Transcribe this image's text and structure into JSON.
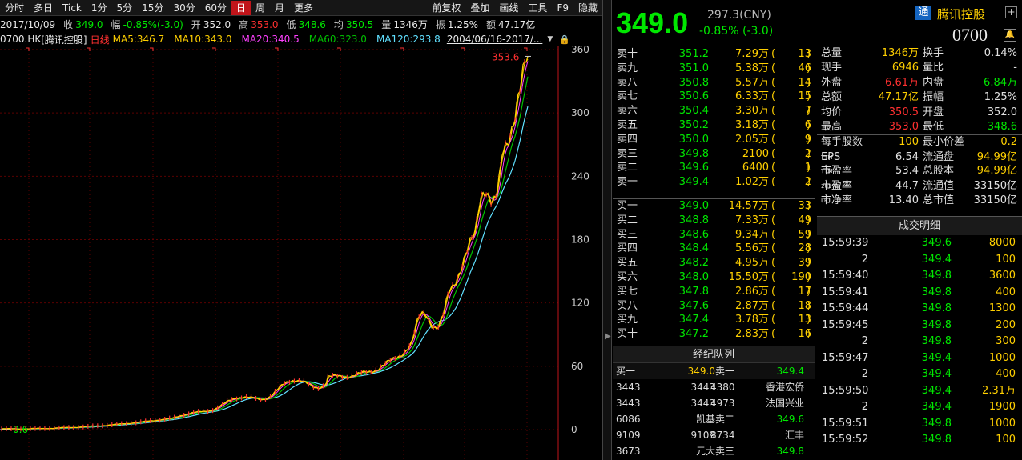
{
  "nav": {
    "tabs": [
      "分时",
      "多日",
      "Tick",
      "1分",
      "5分",
      "15分",
      "30分",
      "60分",
      "日",
      "周",
      "月",
      "更多"
    ],
    "active": 8,
    "tools": [
      "前复权",
      "叠加",
      "画线",
      "工具",
      "F9",
      "隐藏"
    ]
  },
  "info": {
    "date": "2017/10/09",
    "close_lbl": "收",
    "close": "349.0",
    "range_lbl": "幅",
    "range": "-0.85%(-3.0)",
    "open_lbl": "开",
    "open": "352.0",
    "high_lbl": "高",
    "high": "353.0",
    "low_lbl": "低",
    "low": "348.6",
    "avg_lbl": "均",
    "avg": "350.5",
    "vol_lbl": "量",
    "vol": "1346万",
    "amp_lbl": "振",
    "amp": "1.25%",
    "amt_lbl": "额",
    "amt": "47.17亿"
  },
  "ma": {
    "symbol": "0700.HK",
    "name": "[腾讯控股]",
    "period": "日线",
    "ma5": "MA5:346.7",
    "ma10": "MA10:343.0",
    "ma20": "MA20:340.5",
    "ma60": "MA60:323.0",
    "ma120": "MA120:293.8",
    "range": "2004/06/16-2017/..."
  },
  "chart": {
    "y_ticks": [
      "360",
      "300",
      "240",
      "180",
      "120",
      "60",
      "0"
    ],
    "high_label": "353.6",
    "low_label": "0.6"
  },
  "quote": {
    "price": "349.0",
    "prev": "297.3(CNY)",
    "change": "-0.85% (-3.0)",
    "tong": "通",
    "name": "腾讯控股",
    "code": "0700"
  },
  "asks": [
    {
      "lbl": "卖十",
      "price": "351.2",
      "vol": "7.29万",
      "cnt": "13"
    },
    {
      "lbl": "卖九",
      "price": "351.0",
      "vol": "5.38万",
      "cnt": "46"
    },
    {
      "lbl": "卖八",
      "price": "350.8",
      "vol": "5.57万",
      "cnt": "14"
    },
    {
      "lbl": "卖七",
      "price": "350.6",
      "vol": "6.33万",
      "cnt": "15"
    },
    {
      "lbl": "卖六",
      "price": "350.4",
      "vol": "3.30万",
      "cnt": "7"
    },
    {
      "lbl": "卖五",
      "price": "350.2",
      "vol": "3.18万",
      "cnt": "6"
    },
    {
      "lbl": "卖四",
      "price": "350.0",
      "vol": "2.05万",
      "cnt": "9"
    },
    {
      "lbl": "卖三",
      "price": "349.8",
      "vol": "2100",
      "cnt": "2"
    },
    {
      "lbl": "卖二",
      "price": "349.6",
      "vol": "6400",
      "cnt": "1"
    },
    {
      "lbl": "卖一",
      "price": "349.4",
      "vol": "1.02万",
      "cnt": "2"
    }
  ],
  "bids": [
    {
      "lbl": "买一",
      "price": "349.0",
      "vol": "14.57万",
      "cnt": "33"
    },
    {
      "lbl": "买二",
      "price": "348.8",
      "vol": "7.33万",
      "cnt": "49"
    },
    {
      "lbl": "买三",
      "price": "348.6",
      "vol": "9.34万",
      "cnt": "59"
    },
    {
      "lbl": "买四",
      "price": "348.4",
      "vol": "5.56万",
      "cnt": "28"
    },
    {
      "lbl": "买五",
      "price": "348.2",
      "vol": "4.95万",
      "cnt": "39"
    },
    {
      "lbl": "买六",
      "price": "348.0",
      "vol": "15.50万",
      "cnt": "190"
    },
    {
      "lbl": "买七",
      "price": "347.8",
      "vol": "2.86万",
      "cnt": "17"
    },
    {
      "lbl": "买八",
      "price": "347.6",
      "vol": "2.87万",
      "cnt": "18"
    },
    {
      "lbl": "买九",
      "price": "347.4",
      "vol": "3.78万",
      "cnt": "13"
    },
    {
      "lbl": "买十",
      "price": "347.2",
      "vol": "2.83万",
      "cnt": "16"
    }
  ],
  "stats": [
    {
      "l1": "总量",
      "v1": "1346万",
      "c1": "#ffd000",
      "l2": "换手",
      "v2": "0.14%",
      "c2": "#e0e0e0"
    },
    {
      "l1": "现手",
      "v1": "6946",
      "c1": "#ffd000",
      "l2": "量比",
      "v2": "-",
      "c2": "#e0e0e0"
    },
    {
      "l1": "外盘",
      "v1": "6.61万",
      "c1": "#ff3030",
      "l2": "内盘",
      "v2": "6.84万",
      "c2": "#00e800"
    },
    {
      "l1": "总额",
      "v1": "47.17亿",
      "c1": "#ffd000",
      "l2": "振幅",
      "v2": "1.25%",
      "c2": "#e0e0e0"
    },
    {
      "l1": "均价",
      "v1": "350.5",
      "c1": "#ff3030",
      "l2": "开盘",
      "v2": "352.0",
      "c2": "#e0e0e0"
    },
    {
      "l1": "最高",
      "v1": "353.0",
      "c1": "#ff3030",
      "l2": "最低",
      "v2": "348.6",
      "c2": "#00e800"
    },
    {
      "l1": "每手股数",
      "v1": "100",
      "c1": "#ffd000",
      "l2": "最小价差",
      "v2": "0.2",
      "c2": "#ffd000",
      "sep": true
    },
    {
      "l1": "EPS",
      "s1": "TTM",
      "v1": "6.54",
      "c1": "#e0e0e0",
      "l2": "流通盘",
      "v2": "94.99亿",
      "c2": "#ffd000",
      "sep": true
    },
    {
      "l1": "市盈率",
      "s1": "TTM",
      "v1": "53.4",
      "c1": "#e0e0e0",
      "l2": "总股本",
      "v2": "94.99亿",
      "c2": "#ffd000"
    },
    {
      "l1": "市盈率",
      "s1": "2017E",
      "v1": "44.7",
      "c1": "#e0e0e0",
      "l2": "流通值",
      "v2": "33150亿",
      "c2": "#e0e0e0"
    },
    {
      "l1": "市净率",
      "s1": "LF",
      "v1": "13.40",
      "c1": "#e0e0e0",
      "l2": "总市值",
      "v2": "33150亿",
      "c2": "#e0e0e0"
    }
  ],
  "broker_queue": {
    "title": "经纪队列",
    "rows": [
      {
        "c1": "买一",
        "c2": "349.0",
        "c3": "卖一",
        "c4": "349.4",
        "col1": "#ddd",
        "col2": "#ffd000",
        "col3": "#ddd",
        "col4": "#00e800"
      },
      {
        "c1": "3443",
        "c2": "3443",
        "c3": "4380",
        "c4": "香港宏侨",
        "col1": "#ddd",
        "col2": "#ddd",
        "col3": "#ddd",
        "col4": "#ddd"
      },
      {
        "c1": "3443",
        "c2": "3443",
        "c3": "4973",
        "c4": "法国兴业",
        "col1": "#ddd",
        "col2": "#ddd",
        "col3": "#ddd",
        "col4": "#ddd"
      },
      {
        "c1": "6086",
        "c2": "凯基",
        "c3": "卖二",
        "c4": "349.6",
        "col1": "#ddd",
        "col2": "#ddd",
        "col3": "#ddd",
        "col4": "#00e800"
      },
      {
        "c1": "9109",
        "c2": "9109",
        "c3": "8734",
        "c4": "汇丰",
        "col1": "#ddd",
        "col2": "#ddd",
        "col3": "#ddd",
        "col4": "#ddd"
      },
      {
        "c1": "3673",
        "c2": "元大",
        "c3": "卖三",
        "c4": "349.8",
        "col1": "#ddd",
        "col2": "#ddd",
        "col3": "#ddd",
        "col4": "#00e800"
      }
    ]
  },
  "trades": {
    "title": "成交明细",
    "rows": [
      {
        "t": "15:59:39",
        "p": "349.6",
        "v": "8000"
      },
      {
        "t": "2",
        "p": "349.4",
        "v": "100"
      },
      {
        "t": "15:59:40",
        "p": "349.8",
        "v": "3600"
      },
      {
        "t": "15:59:41",
        "p": "349.8",
        "v": "400"
      },
      {
        "t": "15:59:44",
        "p": "349.8",
        "v": "1300"
      },
      {
        "t": "15:59:45",
        "p": "349.8",
        "v": "200"
      },
      {
        "t": "2",
        "p": "349.8",
        "v": "300"
      },
      {
        "t": "15:59:47",
        "p": "349.4",
        "v": "1000"
      },
      {
        "t": "2",
        "p": "349.4",
        "v": "400"
      },
      {
        "t": "15:59:50",
        "p": "349.4",
        "v": "2.31万"
      },
      {
        "t": "2",
        "p": "349.4",
        "v": "1900"
      },
      {
        "t": "15:59:51",
        "p": "349.8",
        "v": "1000"
      },
      {
        "t": "15:59:52",
        "p": "349.8",
        "v": "100"
      }
    ]
  }
}
